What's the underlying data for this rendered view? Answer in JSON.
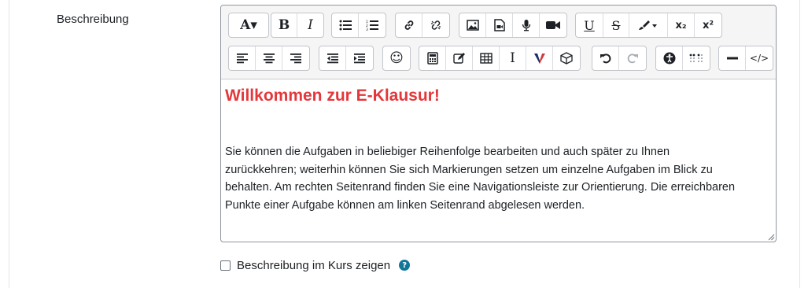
{
  "field": {
    "label": "Beschreibung"
  },
  "toolbar": {
    "row1": [
      {
        "group": "font",
        "items": [
          {
            "name": "font-size-icon",
            "glyph": "A▾"
          }
        ]
      },
      {
        "group": "style",
        "items": [
          {
            "name": "bold-icon",
            "glyph": "B"
          },
          {
            "name": "italic-icon",
            "glyph": "I"
          }
        ]
      },
      {
        "group": "lists",
        "items": [
          {
            "name": "bullet-list-icon"
          },
          {
            "name": "numbered-list-icon"
          }
        ]
      },
      {
        "group": "links",
        "items": [
          {
            "name": "link-icon"
          },
          {
            "name": "unlink-icon"
          }
        ]
      },
      {
        "group": "media",
        "items": [
          {
            "name": "image-icon"
          },
          {
            "name": "media-file-icon"
          },
          {
            "name": "microphone-icon"
          },
          {
            "name": "video-camera-icon"
          }
        ]
      },
      {
        "group": "format",
        "items": [
          {
            "name": "underline-icon",
            "glyph": "U"
          },
          {
            "name": "strikethrough-icon",
            "glyph": "S"
          },
          {
            "name": "paint-brush-icon"
          },
          {
            "name": "subscript-icon",
            "glyph": "x₂"
          },
          {
            "name": "superscript-icon",
            "glyph": "x²"
          }
        ]
      }
    ],
    "row2": [
      {
        "group": "align",
        "items": [
          {
            "name": "align-left-icon"
          },
          {
            "name": "align-center-icon"
          },
          {
            "name": "align-right-icon"
          }
        ]
      },
      {
        "group": "indent",
        "items": [
          {
            "name": "outdent-icon"
          },
          {
            "name": "indent-icon"
          }
        ]
      },
      {
        "group": "emoji",
        "items": [
          {
            "name": "emoji-icon",
            "glyph": "☺"
          }
        ]
      },
      {
        "group": "insert",
        "items": [
          {
            "name": "calculator-icon"
          },
          {
            "name": "edit-icon"
          },
          {
            "name": "table-icon"
          },
          {
            "name": "text-cursor-icon",
            "glyph": "I"
          },
          {
            "name": "v-plugin-icon"
          },
          {
            "name": "cube-icon"
          }
        ]
      },
      {
        "group": "history",
        "items": [
          {
            "name": "undo-icon"
          },
          {
            "name": "redo-icon",
            "disabled": true
          }
        ]
      },
      {
        "group": "access",
        "items": [
          {
            "name": "accessibility-icon"
          },
          {
            "name": "braille-icon"
          }
        ]
      },
      {
        "group": "misc",
        "items": [
          {
            "name": "horizontal-rule-icon"
          },
          {
            "name": "html-code-icon",
            "glyph": "</>"
          }
        ]
      }
    ]
  },
  "content": {
    "heading": "Willkommen zur E-Klausur!",
    "heading_color": "#e4373b",
    "paragraph_lines": [
      "Sie können die Aufgaben in beliebiger Reihenfolge bearbeiten und auch später zu Ihnen",
      "zurückkehren; weiterhin können Sie sich Markierungen setzen um einzelne Aufgaben im Blick zu",
      "behalten. Am rechten Seitenrand finden Sie eine Navigationsleiste zur Orientierung. Die erreichbaren",
      "Punkte einer Aufgabe können am linken Seitenrand abgelesen werden."
    ]
  },
  "show_in_course": {
    "label": "Beschreibung im Kurs zeigen",
    "checked": false,
    "help_glyph": "?"
  }
}
